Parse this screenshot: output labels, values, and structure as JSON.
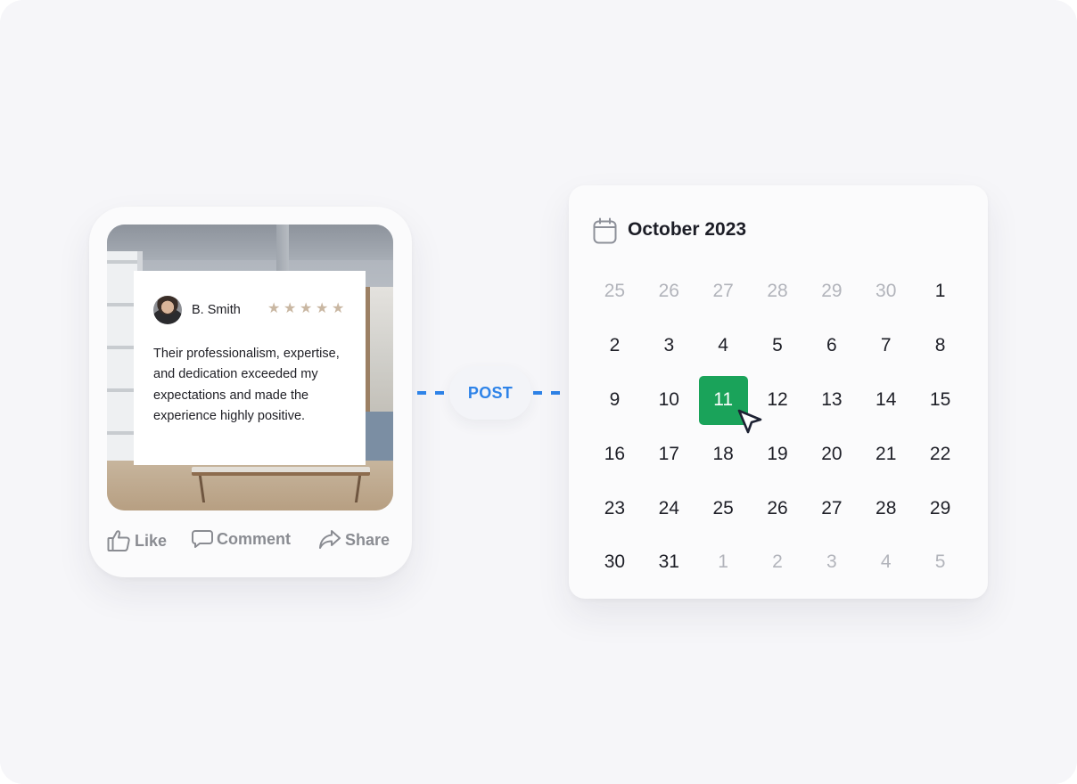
{
  "post": {
    "reviewer_name": "B. Smith",
    "rating": 5,
    "review_text": "Their professionalism, expertise, and dedication exceeded my expectations and made the experience highly positive.",
    "actions": {
      "like": "Like",
      "comment": "Comment",
      "share": "Share"
    }
  },
  "connector": {
    "label": "POST"
  },
  "calendar": {
    "title": "October 2023",
    "selected_day": "11",
    "days": [
      {
        "n": "25",
        "muted": true
      },
      {
        "n": "26",
        "muted": true
      },
      {
        "n": "27",
        "muted": true
      },
      {
        "n": "28",
        "muted": true
      },
      {
        "n": "29",
        "muted": true
      },
      {
        "n": "30",
        "muted": true
      },
      {
        "n": "1",
        "muted": false
      },
      {
        "n": "2",
        "muted": false
      },
      {
        "n": "3",
        "muted": false
      },
      {
        "n": "4",
        "muted": false
      },
      {
        "n": "5",
        "muted": false
      },
      {
        "n": "6",
        "muted": false
      },
      {
        "n": "7",
        "muted": false
      },
      {
        "n": "8",
        "muted": false
      },
      {
        "n": "9",
        "muted": false
      },
      {
        "n": "10",
        "muted": false
      },
      {
        "n": "11",
        "muted": false
      },
      {
        "n": "12",
        "muted": false
      },
      {
        "n": "13",
        "muted": false
      },
      {
        "n": "14",
        "muted": false
      },
      {
        "n": "15",
        "muted": false
      },
      {
        "n": "16",
        "muted": false
      },
      {
        "n": "17",
        "muted": false
      },
      {
        "n": "18",
        "muted": false
      },
      {
        "n": "19",
        "muted": false
      },
      {
        "n": "20",
        "muted": false
      },
      {
        "n": "21",
        "muted": false
      },
      {
        "n": "22",
        "muted": false
      },
      {
        "n": "23",
        "muted": false
      },
      {
        "n": "24",
        "muted": false
      },
      {
        "n": "25",
        "muted": false
      },
      {
        "n": "26",
        "muted": false
      },
      {
        "n": "27",
        "muted": false
      },
      {
        "n": "28",
        "muted": false
      },
      {
        "n": "29",
        "muted": false
      },
      {
        "n": "30",
        "muted": false
      },
      {
        "n": "31",
        "muted": false
      },
      {
        "n": "1",
        "muted": true
      },
      {
        "n": "2",
        "muted": true
      },
      {
        "n": "3",
        "muted": true
      },
      {
        "n": "4",
        "muted": true
      },
      {
        "n": "5",
        "muted": true
      }
    ]
  },
  "colors": {
    "accent_blue": "#2e83e8",
    "selected_green": "#1aa35a",
    "star": "#c9b7a2",
    "muted_text": "#b2b4bb",
    "action_gray": "#8a8c92"
  },
  "icons": {
    "like": "thumbs-up-icon",
    "comment": "comment-icon",
    "share": "share-icon",
    "calendar": "calendar-icon",
    "cursor": "pointer-cursor-icon",
    "star": "star-icon"
  }
}
